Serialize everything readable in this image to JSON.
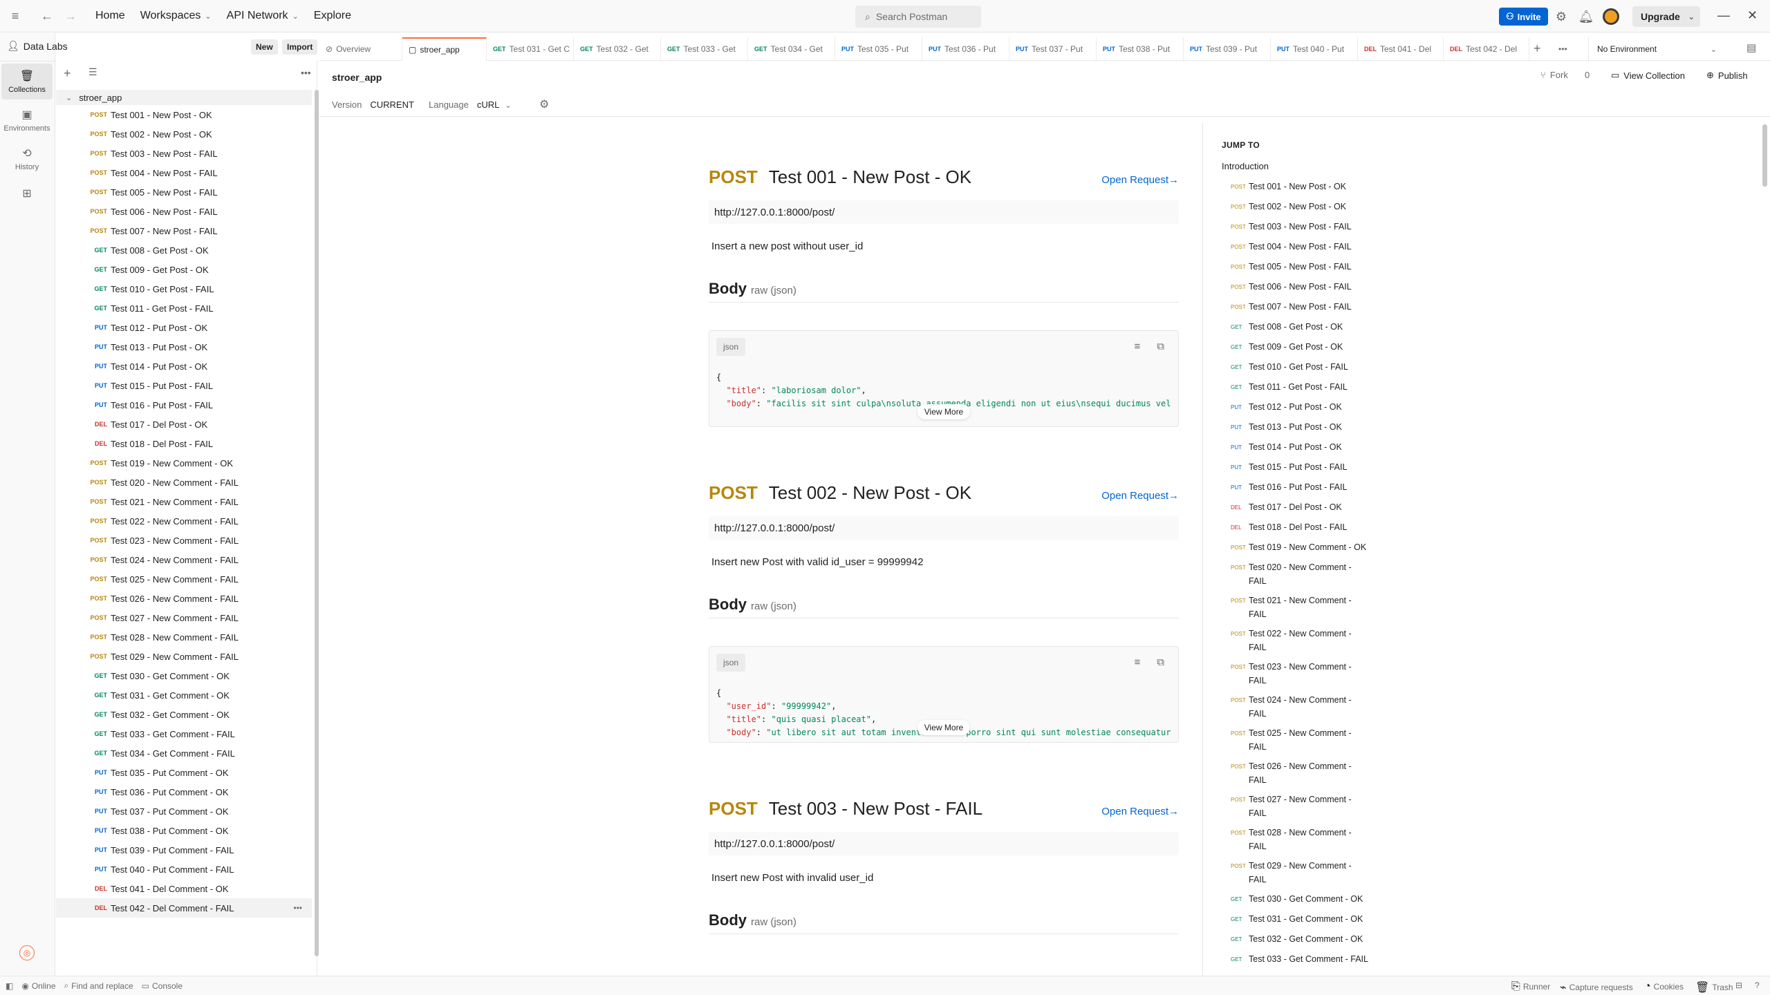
{
  "topbar": {
    "nav": [
      "Home",
      "Workspaces",
      "API Network",
      "Explore"
    ],
    "search_placeholder": "Search Postman",
    "invite": "Invite",
    "upgrade": "Upgrade"
  },
  "workspace": {
    "name": "Data Labs",
    "new_label": "New",
    "import_label": "Import"
  },
  "rail": [
    "Collections",
    "Environments",
    "History"
  ],
  "tree": {
    "root": "stroer_app",
    "items": [
      {
        "m": "POST",
        "n": "Test 001 - New Post - OK"
      },
      {
        "m": "POST",
        "n": "Test 002 - New Post - OK"
      },
      {
        "m": "POST",
        "n": "Test 003 - New Post - FAIL"
      },
      {
        "m": "POST",
        "n": "Test 004 - New Post - FAIL"
      },
      {
        "m": "POST",
        "n": "Test 005 - New Post - FAIL"
      },
      {
        "m": "POST",
        "n": "Test 006 - New Post - FAIL"
      },
      {
        "m": "POST",
        "n": "Test 007 - New Post - FAIL"
      },
      {
        "m": "GET",
        "n": "Test 008 - Get Post - OK"
      },
      {
        "m": "GET",
        "n": "Test 009 - Get Post - OK"
      },
      {
        "m": "GET",
        "n": "Test 010 - Get Post - FAIL"
      },
      {
        "m": "GET",
        "n": "Test 011 - Get Post - FAIL"
      },
      {
        "m": "PUT",
        "n": "Test 012 - Put Post - OK"
      },
      {
        "m": "PUT",
        "n": "Test 013 - Put Post - OK"
      },
      {
        "m": "PUT",
        "n": "Test 014 - Put Post - OK"
      },
      {
        "m": "PUT",
        "n": "Test 015 - Put Post - FAIL"
      },
      {
        "m": "PUT",
        "n": "Test 016 - Put Post - FAIL"
      },
      {
        "m": "DEL",
        "n": "Test 017 - Del Post - OK"
      },
      {
        "m": "DEL",
        "n": "Test 018 - Del Post - FAIL"
      },
      {
        "m": "POST",
        "n": "Test 019 - New Comment - OK"
      },
      {
        "m": "POST",
        "n": "Test 020 - New Comment - FAIL"
      },
      {
        "m": "POST",
        "n": "Test 021 - New Comment - FAIL"
      },
      {
        "m": "POST",
        "n": "Test 022 - New Comment - FAIL"
      },
      {
        "m": "POST",
        "n": "Test 023 - New Comment - FAIL"
      },
      {
        "m": "POST",
        "n": "Test 024 - New Comment - FAIL"
      },
      {
        "m": "POST",
        "n": "Test 025 - New Comment - FAIL"
      },
      {
        "m": "POST",
        "n": "Test 026 - New Comment - FAIL"
      },
      {
        "m": "POST",
        "n": "Test 027 - New Comment - FAIL"
      },
      {
        "m": "POST",
        "n": "Test 028 - New Comment - FAIL"
      },
      {
        "m": "POST",
        "n": "Test 029 - New Comment - FAIL"
      },
      {
        "m": "GET",
        "n": "Test 030 - Get Comment - OK"
      },
      {
        "m": "GET",
        "n": "Test 031 - Get Comment - OK"
      },
      {
        "m": "GET",
        "n": "Test 032 - Get Comment - OK"
      },
      {
        "m": "GET",
        "n": "Test 033 - Get Comment - FAIL"
      },
      {
        "m": "GET",
        "n": "Test 034 - Get Comment - FAIL"
      },
      {
        "m": "PUT",
        "n": "Test 035 - Put Comment - OK"
      },
      {
        "m": "PUT",
        "n": "Test 036 - Put Comment - OK"
      },
      {
        "m": "PUT",
        "n": "Test 037 - Put Comment - OK"
      },
      {
        "m": "PUT",
        "n": "Test 038 - Put Comment - OK"
      },
      {
        "m": "PUT",
        "n": "Test 039 - Put Comment - FAIL"
      },
      {
        "m": "PUT",
        "n": "Test 040 - Put Comment - FAIL"
      },
      {
        "m": "DEL",
        "n": "Test 041 - Del Comment - OK"
      },
      {
        "m": "DEL",
        "n": "Test 042 - Del Comment - FAIL"
      }
    ]
  },
  "tabs": [
    {
      "m": "",
      "n": "Overview"
    },
    {
      "m": "",
      "n": "stroer_app"
    },
    {
      "m": "GET",
      "n": "Test 031 - Get C"
    },
    {
      "m": "GET",
      "n": "Test 032 - Get"
    },
    {
      "m": "GET",
      "n": "Test 033 - Get"
    },
    {
      "m": "GET",
      "n": "Test 034 - Get"
    },
    {
      "m": "PUT",
      "n": "Test 035 - Put"
    },
    {
      "m": "PUT",
      "n": "Test 036 - Put"
    },
    {
      "m": "PUT",
      "n": "Test 037 - Put"
    },
    {
      "m": "PUT",
      "n": "Test 038 - Put"
    },
    {
      "m": "PUT",
      "n": "Test 039 - Put"
    },
    {
      "m": "PUT",
      "n": "Test 040 - Put"
    },
    {
      "m": "DEL",
      "n": "Test 041 - Del"
    },
    {
      "m": "DEL",
      "n": "Test 042 - Del"
    }
  ],
  "environment": "No Environment",
  "collection": {
    "title": "stroer_app",
    "fork": "Fork",
    "fork_count": "0",
    "view_collection": "View Collection",
    "publish": "Publish",
    "version_label": "Version",
    "version": "CURRENT",
    "language_label": "Language",
    "language": "cURL"
  },
  "requests": [
    {
      "method": "POST",
      "name": "Test 001 - New Post - OK",
      "open": "Open Request→",
      "url": "http://127.0.0.1:8000/post/",
      "desc": "Insert a new post without user_id",
      "body_title": "Body",
      "body_type": "raw (json)",
      "lines": [
        [
          [
            "{",
            ""
          ]
        ],
        [
          [
            "  \"title\"",
            "k"
          ],
          [
            ": ",
            ""
          ],
          [
            "\"laboriosam dolor\"",
            "s"
          ],
          [
            ",",
            ""
          ]
        ],
        [
          [
            "  \"body\"",
            "k"
          ],
          [
            ": ",
            ""
          ],
          [
            "\"facilis sit sint culpa\\nsoluta assumenda eligendi non ut eius\\nsequi ducimus vel",
            "s"
          ]
        ]
      ]
    },
    {
      "method": "POST",
      "name": "Test 002 - New Post - OK",
      "open": "Open Request→",
      "url": "http://127.0.0.1:8000/post/",
      "desc": "Insert new Post with valid id_user = 99999942",
      "body_title": "Body",
      "body_type": "raw (json)",
      "lines": [
        [
          [
            "{",
            ""
          ]
        ],
        [
          [
            "  \"user_id\"",
            "k"
          ],
          [
            ": ",
            ""
          ],
          [
            "\"99999942\"",
            "s"
          ],
          [
            ",",
            ""
          ]
        ],
        [
          [
            "  \"title\"",
            "k"
          ],
          [
            ": ",
            ""
          ],
          [
            "\"quis quasi placeat\"",
            "s"
          ],
          [
            ",",
            ""
          ]
        ],
        [
          [
            "  \"body\"",
            "k"
          ],
          [
            ": ",
            ""
          ],
          [
            "\"ut libero sit aut totam inventore sunt porro sint qui sunt molestiae consequatur",
            "s"
          ]
        ]
      ]
    },
    {
      "method": "POST",
      "name": "Test 003 - New Post - FAIL",
      "open": "Open Request→",
      "url": "http://127.0.0.1:8000/post/",
      "desc": "Insert new Post with invalid user_id",
      "body_title": "Body",
      "body_type": "raw (json)",
      "lines": []
    }
  ],
  "code_pill": "json",
  "view_more": "View More",
  "jump": {
    "title": "JUMP TO",
    "intro": "Introduction",
    "items": [
      {
        "m": "POST",
        "n": "Test 001 - New Post - OK"
      },
      {
        "m": "POST",
        "n": "Test 002 - New Post - OK"
      },
      {
        "m": "POST",
        "n": "Test 003 - New Post - FAIL"
      },
      {
        "m": "POST",
        "n": "Test 004 - New Post - FAIL"
      },
      {
        "m": "POST",
        "n": "Test 005 - New Post - FAIL"
      },
      {
        "m": "POST",
        "n": "Test 006 - New Post - FAIL"
      },
      {
        "m": "POST",
        "n": "Test 007 - New Post - FAIL"
      },
      {
        "m": "GET",
        "n": "Test 008 - Get Post - OK"
      },
      {
        "m": "GET",
        "n": "Test 009 - Get Post - OK"
      },
      {
        "m": "GET",
        "n": "Test 010 - Get Post - FAIL"
      },
      {
        "m": "GET",
        "n": "Test 011 - Get Post - FAIL"
      },
      {
        "m": "PUT",
        "n": "Test 012 - Put Post - OK"
      },
      {
        "m": "PUT",
        "n": "Test 013 - Put Post - OK"
      },
      {
        "m": "PUT",
        "n": "Test 014 - Put Post - OK"
      },
      {
        "m": "PUT",
        "n": "Test 015 - Put Post - FAIL"
      },
      {
        "m": "PUT",
        "n": "Test 016 - Put Post - FAIL"
      },
      {
        "m": "DEL",
        "n": "Test 017 - Del Post - OK"
      },
      {
        "m": "DEL",
        "n": "Test 018 - Del Post - FAIL"
      },
      {
        "m": "POST",
        "n": "Test 019 - New Comment - OK"
      },
      {
        "m": "POST",
        "n": "Test 020 - New Comment - FAIL"
      },
      {
        "m": "POST",
        "n": "Test 021 - New Comment - FAIL"
      },
      {
        "m": "POST",
        "n": "Test 022 - New Comment - FAIL"
      },
      {
        "m": "POST",
        "n": "Test 023 - New Comment - FAIL"
      },
      {
        "m": "POST",
        "n": "Test 024 - New Comment - FAIL"
      },
      {
        "m": "POST",
        "n": "Test 025 - New Comment - FAIL"
      },
      {
        "m": "POST",
        "n": "Test 026 - New Comment - FAIL"
      },
      {
        "m": "POST",
        "n": "Test 027 - New Comment - FAIL"
      },
      {
        "m": "POST",
        "n": "Test 028 - New Comment - FAIL"
      },
      {
        "m": "POST",
        "n": "Test 029 - New Comment - FAIL"
      },
      {
        "m": "GET",
        "n": "Test 030 - Get Comment - OK"
      },
      {
        "m": "GET",
        "n": "Test 031 - Get Comment - OK"
      },
      {
        "m": "GET",
        "n": "Test 032 - Get Comment - OK"
      },
      {
        "m": "GET",
        "n": "Test 033 - Get Comment - FAIL"
      },
      {
        "m": "GET",
        "n": "Test 034 - Get Comment - FAIL"
      }
    ]
  },
  "status": {
    "online": "Online",
    "find": "Find and replace",
    "console": "Console",
    "runner": "Runner",
    "capture": "Capture requests",
    "cookies": "Cookies",
    "trash": "Trash"
  },
  "colors": {
    "accent": "#ff6c37",
    "post": "#b8860b",
    "get": "#00875a",
    "put": "#0265d2",
    "del": "#c9302c",
    "link": "#0265d2"
  }
}
